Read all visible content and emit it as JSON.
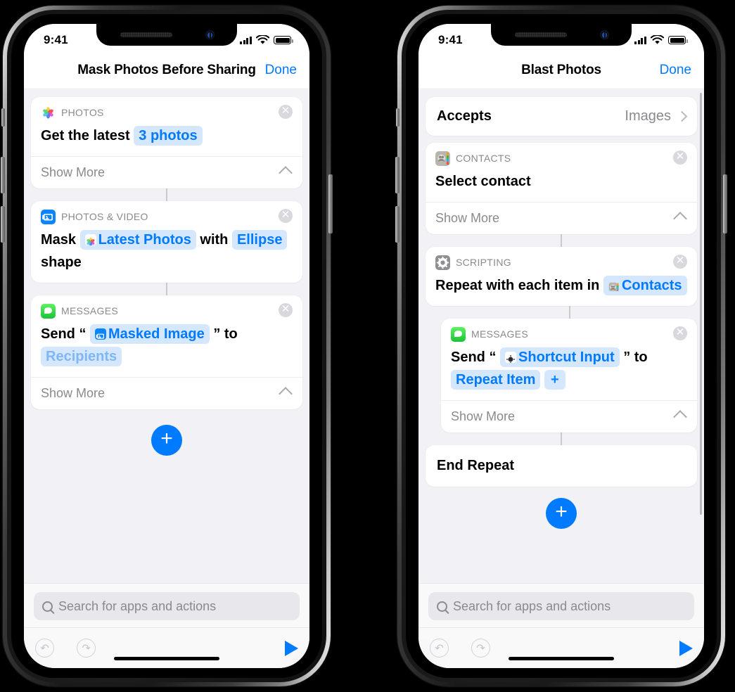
{
  "status_bar": {
    "time": "9:41",
    "signal_icon": "cellular-bars-icon",
    "wifi_icon": "wifi-icon",
    "battery_icon": "battery-icon"
  },
  "search": {
    "placeholder": "Search for apps and actions",
    "icon": "search-icon"
  },
  "toolbar": {
    "undo_icon": "undo-icon",
    "redo_icon": "redo-icon",
    "play_icon": "play-icon"
  },
  "colors": {
    "accent": "#007aff",
    "token_bg": "#d4e7fd",
    "token_text": "#007aff",
    "card_bg": "#ffffff",
    "page_bg": "#f1f1f6",
    "messages_green": "#19c235",
    "photos_video_blue": "#0a84ff"
  },
  "left_phone": {
    "nav": {
      "title": "Mask Photos Before Sharing",
      "done_label": "Done"
    },
    "add_button_label": "+",
    "cards": [
      {
        "category": "PHOTOS",
        "icon": "photos-app-icon",
        "close_label": "✕",
        "parts": [
          {
            "type": "text",
            "value": "Get the latest"
          },
          {
            "type": "token",
            "value": "3 photos"
          }
        ],
        "show_more": "Show More"
      },
      {
        "category": "PHOTOS & VIDEO",
        "icon": "photos-video-app-icon",
        "close_label": "✕",
        "parts": [
          {
            "type": "text",
            "value": "Mask"
          },
          {
            "type": "token",
            "value": "Latest Photos",
            "token_icon": "photos-app-icon"
          },
          {
            "type": "text",
            "value": "with"
          },
          {
            "type": "token",
            "value": "Ellipse"
          },
          {
            "type": "text",
            "value": "shape"
          }
        ],
        "show_more": null
      },
      {
        "category": "MESSAGES",
        "icon": "messages-app-icon",
        "close_label": "✕",
        "parts": [
          {
            "type": "text",
            "value": "Send “"
          },
          {
            "type": "token",
            "value": "Masked Image",
            "token_icon": "photos-video-app-icon"
          },
          {
            "type": "text",
            "value": "” to"
          },
          {
            "type": "token",
            "value": "Recipients",
            "ghost": true
          }
        ],
        "show_more": "Show More"
      }
    ]
  },
  "right_phone": {
    "nav": {
      "title": "Blast Photos",
      "done_label": "Done"
    },
    "accepts": {
      "label": "Accepts",
      "value": "Images",
      "chevron_icon": "chevron-right-icon"
    },
    "end_repeat_label": "End Repeat",
    "add_button_label": "+",
    "cards": [
      {
        "category": "CONTACTS",
        "icon": "contacts-app-icon",
        "close_label": "✕",
        "parts": [
          {
            "type": "text",
            "value": "Select contact"
          }
        ],
        "show_more": "Show More"
      },
      {
        "category": "SCRIPTING",
        "icon": "scripting-app-icon",
        "close_label": "✕",
        "parts": [
          {
            "type": "text",
            "value": "Repeat with each item in"
          },
          {
            "type": "token",
            "value": "Contacts",
            "token_icon": "contacts-app-icon"
          }
        ],
        "show_more": null
      },
      {
        "category": "MESSAGES",
        "icon": "messages-app-icon",
        "close_label": "✕",
        "indent": true,
        "parts": [
          {
            "type": "text",
            "value": "Send “"
          },
          {
            "type": "token",
            "value": "Shortcut Input",
            "token_icon": "shortcut-input-icon"
          },
          {
            "type": "text",
            "value": "” to"
          },
          {
            "type": "token",
            "value": "Repeat Item"
          },
          {
            "type": "token",
            "value": "+",
            "plus": true
          }
        ],
        "show_more": "Show More"
      }
    ]
  }
}
